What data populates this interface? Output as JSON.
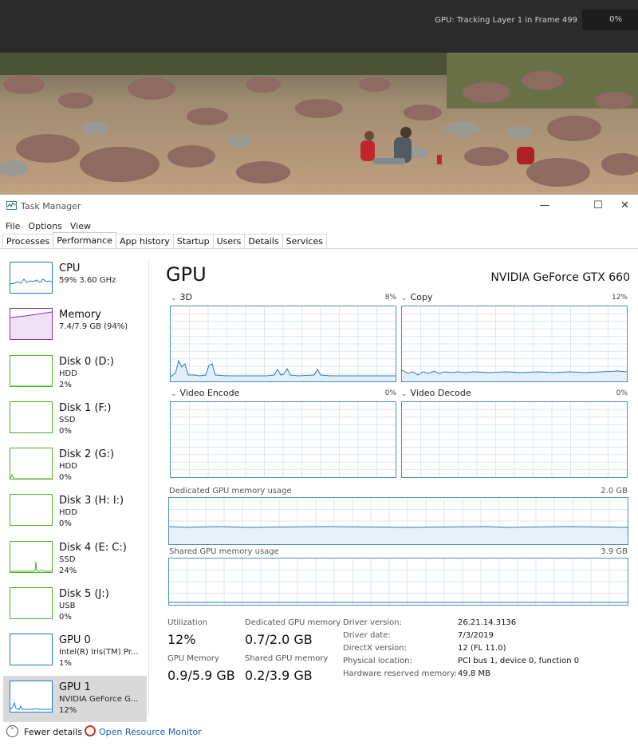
{
  "topbar": {
    "status": "GPU: Tracking Layer 1 in Frame 499",
    "percent": "0%"
  },
  "window": {
    "title": "Task Manager",
    "controls": {
      "minimize": "—",
      "maximize": "☐",
      "close": "✕"
    }
  },
  "menu": [
    "File",
    "Options",
    "View"
  ],
  "tabs": [
    {
      "label": "Processes",
      "active": false
    },
    {
      "label": "Performance",
      "active": true
    },
    {
      "label": "App history",
      "active": false
    },
    {
      "label": "Startup",
      "active": false
    },
    {
      "label": "Users",
      "active": false
    },
    {
      "label": "Details",
      "active": false
    },
    {
      "label": "Services",
      "active": false
    }
  ],
  "sidebar": [
    {
      "name": "CPU",
      "line1": "59% 3.60 GHz",
      "line2": "",
      "color": "#1a7ad6",
      "kind": "cpu"
    },
    {
      "name": "Memory",
      "line1": "7.4/7.9 GB (94%)",
      "line2": "",
      "color": "#8b2fa3",
      "kind": "mem"
    },
    {
      "name": "Disk 0 (D:)",
      "line1": "HDD",
      "line2": "2%",
      "color": "#4caf24",
      "kind": "disk0"
    },
    {
      "name": "Disk 1 (F:)",
      "line1": "SSD",
      "line2": "0%",
      "color": "#4caf24",
      "kind": "flat"
    },
    {
      "name": "Disk 2 (G:)",
      "line1": "HDD",
      "line2": "0%",
      "color": "#4caf24",
      "kind": "disk2"
    },
    {
      "name": "Disk 3 (H: I:)",
      "line1": "HDD",
      "line2": "0%",
      "color": "#4caf24",
      "kind": "flat"
    },
    {
      "name": "Disk 4 (E: C:)",
      "line1": "SSD",
      "line2": "24%",
      "color": "#4caf24",
      "kind": "disk4"
    },
    {
      "name": "Disk 5 (J:)",
      "line1": "USB",
      "line2": "0%",
      "color": "#4caf24",
      "kind": "flat"
    },
    {
      "name": "GPU 0",
      "line1": "Intel(R) Iris(TM) Pr...",
      "line2": "1%",
      "color": "#1a7ad6",
      "kind": "flat"
    },
    {
      "name": "GPU 1",
      "line1": "NVIDIA GeForce G...",
      "line2": "12%",
      "color": "#1a7ad6",
      "kind": "gpu1"
    }
  ],
  "main": {
    "title": "GPU",
    "model": "NVIDIA GeForce GTX 660",
    "engines": [
      {
        "label": "3D",
        "percent": "8%"
      },
      {
        "label": "Copy",
        "percent": "12%"
      },
      {
        "label": "Video Encode",
        "percent": "0%"
      },
      {
        "label": "Video Decode",
        "percent": "0%"
      }
    ],
    "dedicated": {
      "label": "Dedicated GPU memory usage",
      "max": "2.0 GB"
    },
    "shared": {
      "label": "Shared GPU memory usage",
      "max": "3.9 GB"
    }
  },
  "stats": {
    "utilization": {
      "label": "Utilization",
      "value": "12%"
    },
    "dedicated_memory": {
      "label": "Dedicated GPU memory",
      "value": "0.7/2.0 GB"
    },
    "gpu_memory": {
      "label": "GPU Memory",
      "value": "0.9/5.9 GB"
    },
    "shared_memory": {
      "label": "Shared GPU memory",
      "value": "0.2/3.9 GB"
    }
  },
  "info": [
    {
      "label": "Driver version:",
      "value": "26.21.14.3136"
    },
    {
      "label": "Driver date:",
      "value": "7/3/2019"
    },
    {
      "label": "DirectX version:",
      "value": "12 (FL 11.0)"
    },
    {
      "label": "Physical location:",
      "value": "PCI bus 1, device 0, function 0"
    },
    {
      "label": "Hardware reserved memory:",
      "value": "49.8 MB"
    }
  ],
  "footer": {
    "fewer_details": "Fewer details",
    "open_resource_monitor": "Open Resource Monitor"
  },
  "colors": {
    "accent": "#1a7ad6",
    "graph_border": "#4a8fc4",
    "link": "#1a5fb4"
  }
}
